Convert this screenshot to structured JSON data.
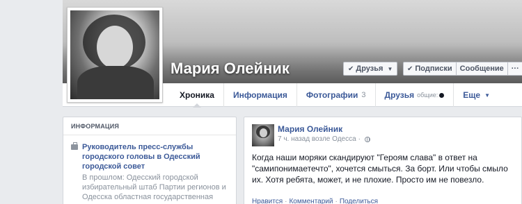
{
  "profile": {
    "name": "Мария Олейник",
    "buttons": {
      "friends": "Друзья",
      "subscriptions": "Подписки",
      "message": "Сообщение",
      "more": "···"
    }
  },
  "tabs": [
    {
      "label": "Хроника"
    },
    {
      "label": "Информация"
    },
    {
      "label": "Фотографии",
      "count": "3"
    },
    {
      "label": "Друзья",
      "sub": "общие:"
    },
    {
      "label": "Еще"
    }
  ],
  "info": {
    "heading": "ИНФОРМАЦИЯ",
    "item_title": "Руководитель пресс-службы городского головы в Одесский городской совет",
    "item_sub": "В прошлом: Одесский городской избирательный штаб Партии регионов и Одесска областная государственная администрация"
  },
  "post": {
    "author": "Мария Олейник",
    "time": "7 ч. назад возле Одесса",
    "text": "Когда наши моряки скандируют \"Героям слава\" в ответ на \"самипонимаетечто\", хочется смыться. За борт. Или чтобы смыло их. Хотя ребята, может, и не плохие. Просто им не повезло.",
    "actions": [
      "Нравится",
      "Комментарий",
      "Поделиться"
    ]
  }
}
